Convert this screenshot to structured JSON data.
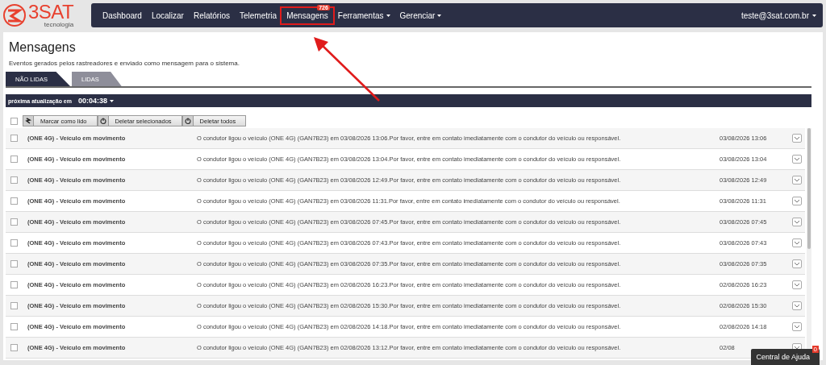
{
  "logo": {
    "name": "3SAT",
    "tagline": "tecnologia"
  },
  "nav": {
    "items": [
      {
        "label": "Dashboard",
        "dropdown": false,
        "highlighted": false
      },
      {
        "label": "Localizar",
        "dropdown": false,
        "highlighted": false
      },
      {
        "label": "Relatórios",
        "dropdown": false,
        "highlighted": false
      },
      {
        "label": "Telemetria",
        "dropdown": false,
        "highlighted": false
      },
      {
        "label": "Mensagens",
        "badge": "726",
        "dropdown": false,
        "highlighted": true
      },
      {
        "label": "Ferramentas",
        "dropdown": true,
        "highlighted": false
      },
      {
        "label": "Gerenciar",
        "dropdown": true,
        "highlighted": false
      }
    ],
    "user": "teste@3sat.com.br"
  },
  "page": {
    "title": "Mensagens",
    "subtitle": "Eventos gerados pelos rastreadores e enviado como mensagem para o sistema."
  },
  "tabs": [
    {
      "label": "NÃO LIDAS",
      "selected": true
    },
    {
      "label": "LIDAS",
      "selected": false
    }
  ],
  "refresh": {
    "label": "próxima atualização em",
    "time": "00:04:38"
  },
  "toolbar": {
    "select_all": false,
    "buttons": [
      "Marcar como lido",
      "Deletar selecionados",
      "Deletar todos"
    ]
  },
  "messages": [
    {
      "checked": false,
      "title": "(ONE 4G) - Veículo em movimento",
      "text": "O condutor ligou o veículo (ONE 4G) (GAN7B23) em 03/08/2026 13:06.Por favor, entre em contato imediatamente com o condutor do veículo ou responsável.",
      "date": "03/08/2026 13:06"
    },
    {
      "checked": false,
      "title": "(ONE 4G) - Veículo em movimento",
      "text": "O condutor ligou o veículo (ONE 4G) (GAN7B23) em 03/08/2026 13:04.Por favor, entre em contato imediatamente com o condutor do veículo ou responsável.",
      "date": "03/08/2026 13:04"
    },
    {
      "checked": false,
      "title": "(ONE 4G) - Veículo em movimento",
      "text": "O condutor ligou o veículo (ONE 4G) (GAN7B23) em 03/08/2026 12:49.Por favor, entre em contato imediatamente com o condutor do veículo ou responsável.",
      "date": "03/08/2026 12:49"
    },
    {
      "checked": false,
      "title": "(ONE 4G) - Veículo em movimento",
      "text": "O condutor ligou o veículo (ONE 4G) (GAN7B23) em 03/08/2026 11:31.Por favor, entre em contato imediatamente com o condutor do veículo ou responsável.",
      "date": "03/08/2026 11:31"
    },
    {
      "checked": false,
      "title": "(ONE 4G) - Veículo em movimento",
      "text": "O condutor ligou o veículo (ONE 4G) (GAN7B23) em 03/08/2026 07:45.Por favor, entre em contato imediatamente com o condutor do veículo ou responsável.",
      "date": "03/08/2026 07:45"
    },
    {
      "checked": false,
      "title": "(ONE 4G) - Veículo em movimento",
      "text": "O condutor ligou o veículo (ONE 4G) (GAN7B23) em 03/08/2026 07:43.Por favor, entre em contato imediatamente com o condutor do veículo ou responsável.",
      "date": "03/08/2026 07:43"
    },
    {
      "checked": false,
      "title": "(ONE 4G) - Veículo em movimento",
      "text": "O condutor ligou o veículo (ONE 4G) (GAN7B23) em 03/08/2026 07:35.Por favor, entre em contato imediatamente com o condutor do veículo ou responsável.",
      "date": "03/08/2026 07:35"
    },
    {
      "checked": false,
      "title": "(ONE 4G) - Veículo em movimento",
      "text": "O condutor ligou o veículo (ONE 4G) (GAN7B23) em 02/08/2026 16:23.Por favor, entre em contato imediatamente com o condutor do veículo ou responsável.",
      "date": "02/08/2026 16:23"
    },
    {
      "checked": false,
      "title": "(ONE 4G) - Veículo em movimento",
      "text": "O condutor ligou o veículo (ONE 4G) (GAN7B23) em 02/08/2026 15:30.Por favor, entre em contato imediatamente com o condutor do veículo ou responsável.",
      "date": "02/08/2026 15:30"
    },
    {
      "checked": false,
      "title": "(ONE 4G) - Veículo em movimento",
      "text": "O condutor ligou o veículo (ONE 4G) (GAN7B23) em 02/08/2026 14:18.Por favor, entre em contato imediatamente com o condutor do veículo ou responsável.",
      "date": "02/08/2026 14:18"
    },
    {
      "checked": false,
      "title": "(ONE 4G) - Veículo em movimento",
      "text": "O condutor ligou o veículo (ONE 4G) (GAN7B23) em 02/08/2026 13:12.Por favor, entre em contato imediatamente com o condutor do veículo ou responsável.",
      "date": "02/08"
    }
  ],
  "help": {
    "label": "Central de Ajuda",
    "badge": "0"
  }
}
